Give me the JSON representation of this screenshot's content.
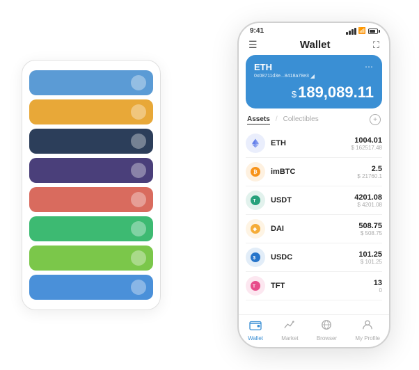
{
  "app": {
    "title": "Wallet"
  },
  "status_bar": {
    "time": "9:41"
  },
  "hero_card": {
    "coin": "ETH",
    "address": "0x08711d3e...8418a78e3",
    "balance": "189,089.11",
    "currency_symbol": "$"
  },
  "assets_section": {
    "tab_active": "Assets",
    "tab_inactive": "Collectibles",
    "slash": "/"
  },
  "assets": [
    {
      "name": "ETH",
      "balance": "1004.01",
      "usd": "$ 162517.48",
      "icon": "eth",
      "color": "#627EEA"
    },
    {
      "name": "imBTC",
      "balance": "2.5",
      "usd": "$ 21760.1",
      "icon": "imbtc",
      "color": "#F7931A"
    },
    {
      "name": "USDT",
      "balance": "4201.08",
      "usd": "$ 4201.08",
      "icon": "usdt",
      "color": "#26A17B"
    },
    {
      "name": "DAI",
      "balance": "508.75",
      "usd": "$ 508.75",
      "icon": "dai",
      "color": "#F5AC37"
    },
    {
      "name": "USDC",
      "balance": "101.25",
      "usd": "$ 101.25",
      "icon": "usdc",
      "color": "#2775CA"
    },
    {
      "name": "TFT",
      "balance": "13",
      "usd": "0",
      "icon": "tft",
      "color": "#E74C8B"
    }
  ],
  "bottom_nav": [
    {
      "label": "Wallet",
      "icon": "wallet",
      "active": true
    },
    {
      "label": "Market",
      "icon": "market",
      "active": false
    },
    {
      "label": "Browser",
      "icon": "browser",
      "active": false
    },
    {
      "label": "My Profile",
      "icon": "profile",
      "active": false
    }
  ],
  "card_stack": [
    {
      "color_class": "card-blue"
    },
    {
      "color_class": "card-orange"
    },
    {
      "color_class": "card-dark"
    },
    {
      "color_class": "card-purple"
    },
    {
      "color_class": "card-red"
    },
    {
      "color_class": "card-green"
    },
    {
      "color_class": "card-lime"
    },
    {
      "color_class": "card-blue2"
    }
  ]
}
